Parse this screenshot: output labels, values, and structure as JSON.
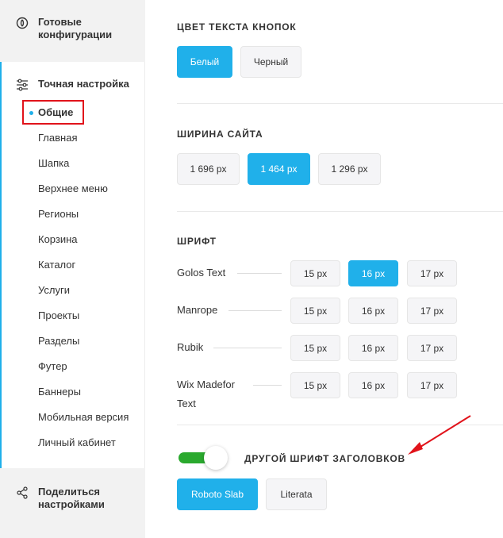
{
  "sidebar": {
    "ready_configs": "Готовые конфигурации",
    "fine_tuning": "Точная настройка",
    "items": [
      "Общие",
      "Главная",
      "Шапка",
      "Верхнее меню",
      "Регионы",
      "Корзина",
      "Каталог",
      "Услуги",
      "Проекты",
      "Разделы",
      "Футер",
      "Баннеры",
      "Мобильная версия",
      "Личный кабинет"
    ],
    "share_settings": "Поделиться настройками"
  },
  "button_text_color": {
    "title": "ЦВЕТ ТЕКСТА КНОПОК",
    "options": [
      "Белый",
      "Черный"
    ],
    "selected": "Белый"
  },
  "site_width": {
    "title": "ШИРИНА САЙТА",
    "options": [
      "1 696 px",
      "1 464 px",
      "1 296 px"
    ],
    "selected": "1 464 px"
  },
  "font": {
    "title": "ШРИФТ",
    "sizes": [
      "15 px",
      "16 px",
      "17 px"
    ],
    "fonts": [
      {
        "name": "Golos Text",
        "selected_size": "16 px"
      },
      {
        "name": "Manrope",
        "selected_size": ""
      },
      {
        "name": "Rubik",
        "selected_size": ""
      },
      {
        "name": "Wix Madefor Text",
        "selected_size": ""
      }
    ]
  },
  "heading_font": {
    "toggle_label": "ДРУГОЙ ШРИФТ ЗАГОЛОВКОВ",
    "toggle_on": true,
    "options": [
      "Roboto Slab",
      "Literata"
    ],
    "selected": "Roboto Slab"
  },
  "colors": {
    "accent": "#20b0ea",
    "toggle_on": "#2aa92e",
    "highlight_box": "#e1131b",
    "arrow": "#e1131b"
  }
}
